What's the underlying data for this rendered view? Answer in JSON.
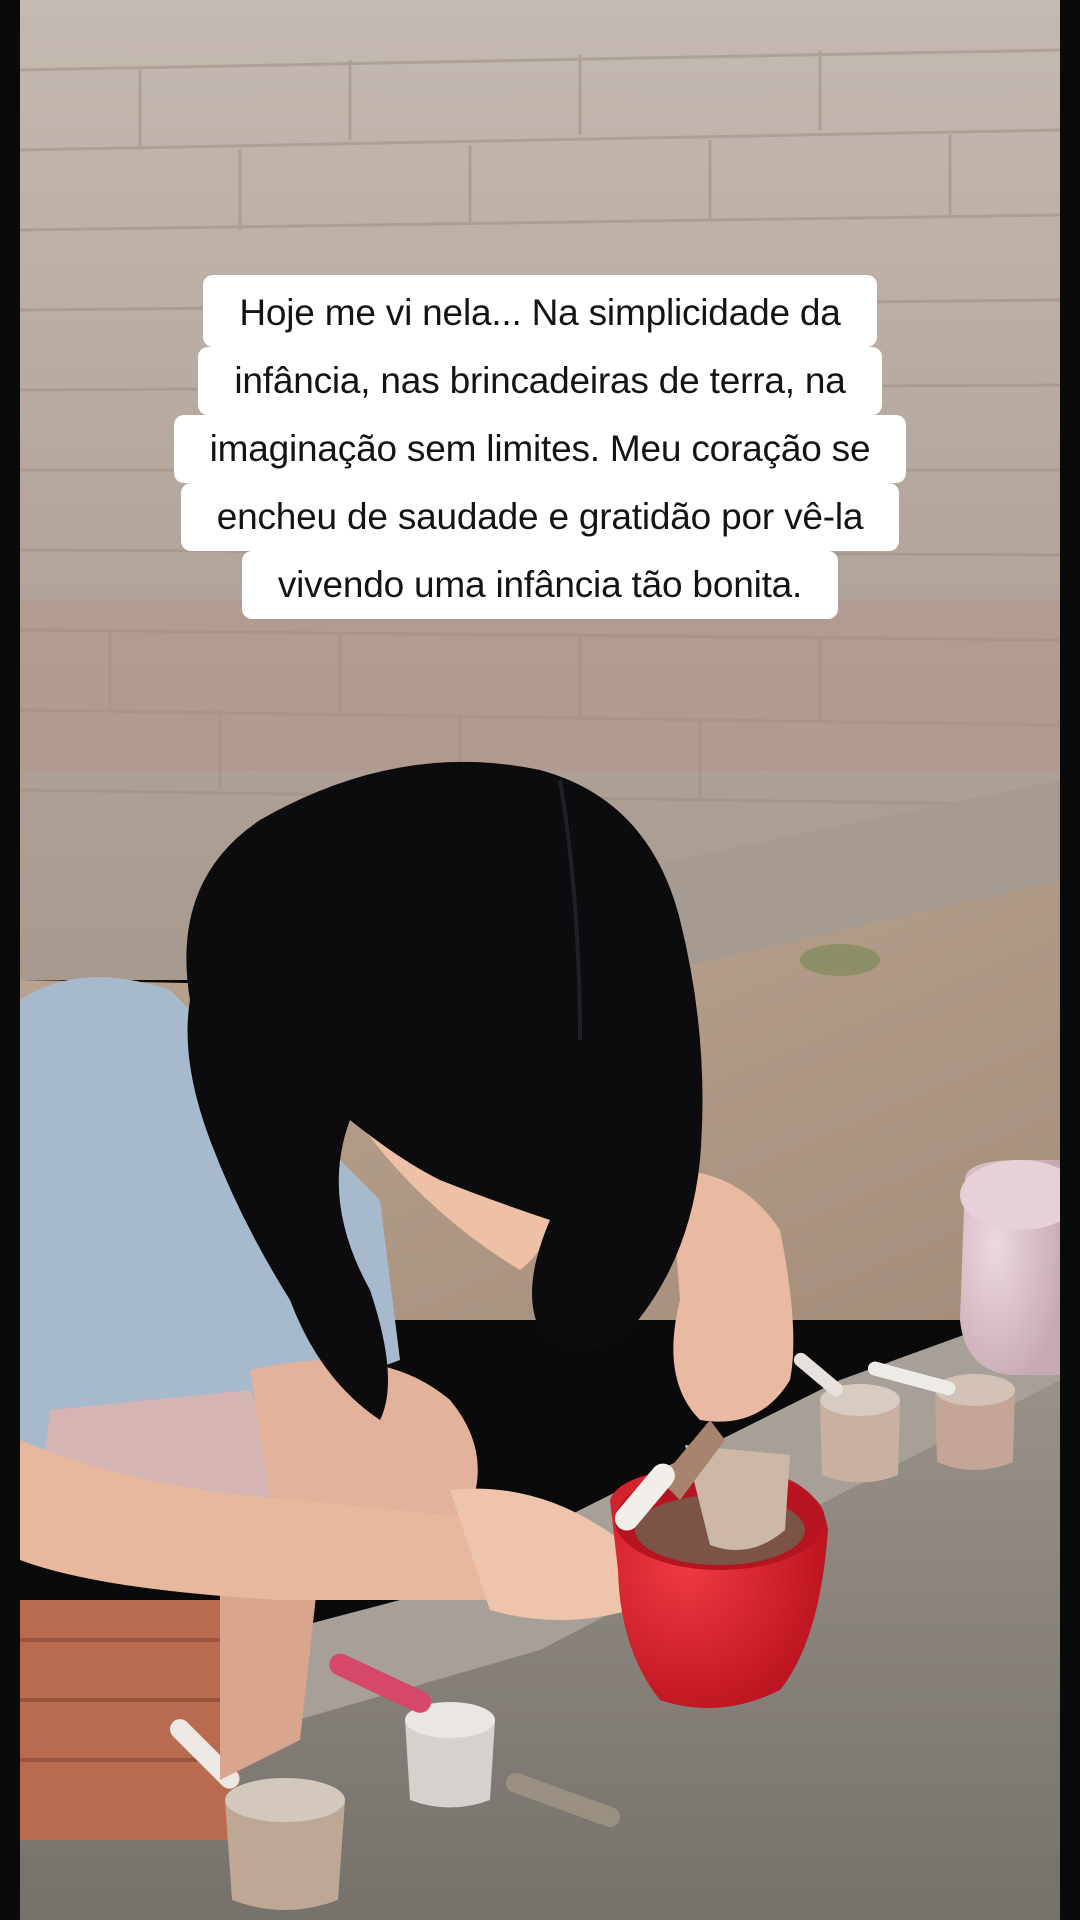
{
  "video": {
    "caption_lines": [
      "Hoje me vi nela... Na simplicidade da",
      "infância, nas brincadeiras de terra, na",
      "imaginação sem limites. Meu coração se",
      "encheu de saudade e gratidão por vê-la",
      "vivendo uma infância tão bonita."
    ]
  },
  "colors": {
    "caption_background": "#ffffff",
    "caption_text": "#141414",
    "wall": "#b7aca3",
    "ground": "#b19a86",
    "ledge": "#8d8780",
    "hair": "#0c0b0e",
    "shirt": "#a7b9cc",
    "red_bowl": "#d81c28",
    "pink_bowl": "#d9c1ca"
  }
}
